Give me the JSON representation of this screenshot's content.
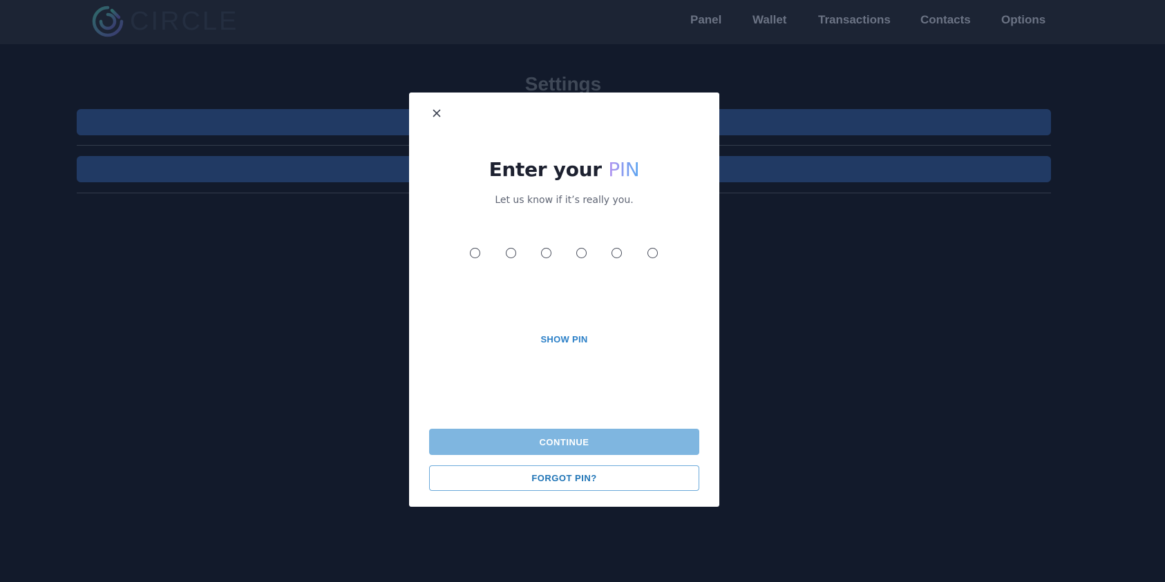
{
  "header": {
    "logo_text": "CIRCLE",
    "logo_icon": "circle-logo-icon",
    "nav": [
      {
        "label": "Panel"
      },
      {
        "label": "Wallet"
      },
      {
        "label": "Transactions"
      },
      {
        "label": "Contacts"
      },
      {
        "label": "Options"
      }
    ]
  },
  "settings": {
    "title": "Settings"
  },
  "modal": {
    "close_icon": "close-icon",
    "title_prefix": "Enter your ",
    "title_accent": "PIN",
    "subtitle": "Let us know if it’s really you.",
    "pin_length": 6,
    "show_pin_label": "SHOW PIN",
    "continue_label": "CONTINUE",
    "forgot_label": "FORGOT PIN?"
  },
  "colors": {
    "page_bg": "#121a2b",
    "topbar_bg": "#1c2434",
    "settings_row": "#213a64",
    "accent_blue": "#2a7fc7",
    "continue_disabled": "#7fb6e0",
    "pin_gradient_start": "#b593f0",
    "pin_gradient_end": "#58a4f0"
  }
}
